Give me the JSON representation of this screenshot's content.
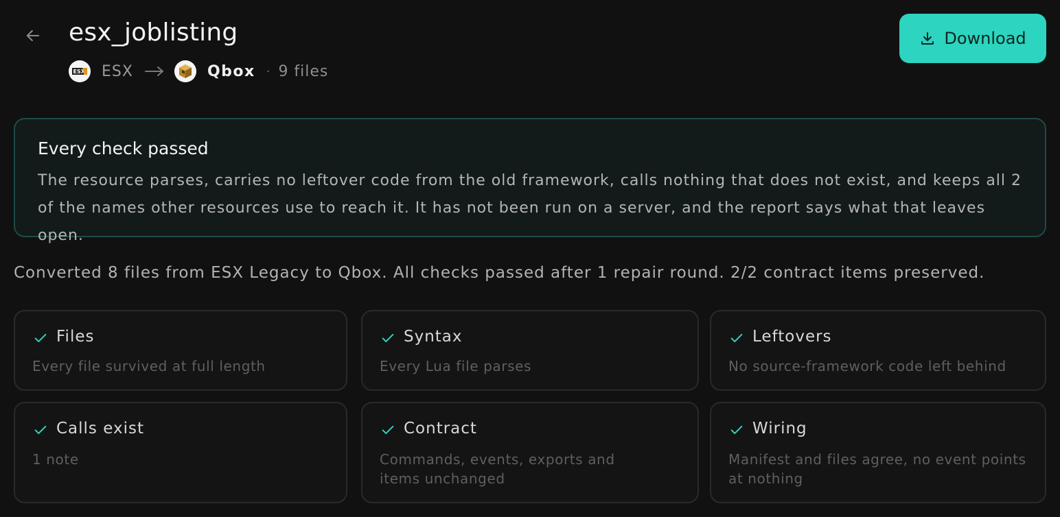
{
  "header": {
    "title": "esx_joblisting",
    "source_framework": "ESX",
    "source_logo_text": "ESX",
    "target_framework": "Qbox",
    "file_count": "9 files",
    "separator": "·",
    "download_label": "Download"
  },
  "banner": {
    "title": "Every check passed",
    "text": "The resource parses, carries no leftover code from the old framework, calls nothing that does not exist, and keeps all 2 of the names other resources use to reach it. It has not been run on a server, and the report says what that leaves open."
  },
  "summary": "Converted 8 files from ESX Legacy to Qbox. All checks passed after 1 repair round. 2/2 contract items preserved.",
  "checks": [
    {
      "title": "Files",
      "desc": "Every file survived at full length"
    },
    {
      "title": "Syntax",
      "desc": "Every Lua file parses"
    },
    {
      "title": "Leftovers",
      "desc": "No source-framework code left behind"
    },
    {
      "title": "Calls exist",
      "desc": "1 note"
    },
    {
      "title": "Contract",
      "desc": "Commands, events, exports and items unchanged"
    },
    {
      "title": "Wiring",
      "desc": "Manifest and files agree, no event points at nothing"
    }
  ],
  "colors": {
    "accent": "#2dd4bf",
    "background": "#111111",
    "banner_border": "#1f4b47"
  },
  "icons": {
    "back": "arrow-left-icon",
    "arrow": "arrow-right-icon",
    "download": "download-icon",
    "check": "check-icon"
  }
}
